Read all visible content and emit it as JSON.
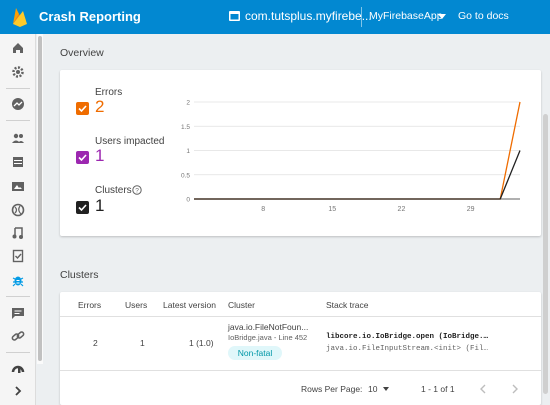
{
  "header": {
    "app_title": "Crash Reporting",
    "project_name": "com.tutsplus.myfirebe...",
    "app_selector": "MyFirebaseApp",
    "docs_link": "Go to docs"
  },
  "sidebar": {
    "items": [
      "home-icon",
      "settings-icon",
      "analytics-icon",
      "users-icon",
      "database-icon",
      "storage-icon",
      "hosting-icon",
      "remote-config-icon",
      "test-lab-icon",
      "crash-reporting-icon",
      "notifications-icon",
      "dynamic-links-icon",
      "admob-icon",
      "expand-icon"
    ]
  },
  "overview": {
    "section_title": "Overview",
    "metrics": [
      {
        "label": "Errors",
        "value": "2",
        "color": "#ef6c00"
      },
      {
        "label": "Users impacted",
        "value": "1",
        "color": "#9c27b0"
      },
      {
        "label": "Clusters",
        "value": "1",
        "color": "#212121"
      }
    ],
    "clusters_help_icon": "help-icon"
  },
  "chart_data": {
    "type": "line",
    "x_tick_labels": [
      "8",
      "15",
      "22",
      "29"
    ],
    "y_tick_labels": [
      "0",
      "0.5",
      "1",
      "1.5",
      "2"
    ],
    "ylim": [
      0,
      2
    ],
    "xlim": [
      1,
      34
    ],
    "x_ticks": [
      8,
      15,
      22,
      29
    ],
    "series": [
      {
        "color": "#ef6c00",
        "x": [
          1,
          32,
          34
        ],
        "y": [
          0,
          0,
          2
        ]
      },
      {
        "color": "#212121",
        "x": [
          1,
          32,
          34
        ],
        "y": [
          0,
          0,
          1
        ]
      }
    ],
    "grid": true
  },
  "clusters": {
    "section_title": "Clusters",
    "columns": [
      "Errors",
      "Users",
      "Latest version",
      "Cluster",
      "Stack trace"
    ],
    "rows": [
      {
        "errors": "2",
        "users": "1",
        "latest_version": "1 (1.0)",
        "cluster_name": "java.io.FileNotFoun...",
        "cluster_location": "IoBridge.java - Line 452",
        "badge": "Non-fatal",
        "stack_line1": "libcore.io.IoBridge.open (IoBridge.…",
        "stack_line2": "java.io.FileInputStream.<init> (Fil…"
      }
    ],
    "pagination": {
      "rows_per_page_label": "Rows Per Page:",
      "rows_per_page_value": "10",
      "range": "1 - 1 of 1"
    }
  },
  "colors": {
    "topbar": "#0288d1",
    "accent": "#039be5",
    "errors": "#ef6c00",
    "users": "#9c27b0"
  }
}
